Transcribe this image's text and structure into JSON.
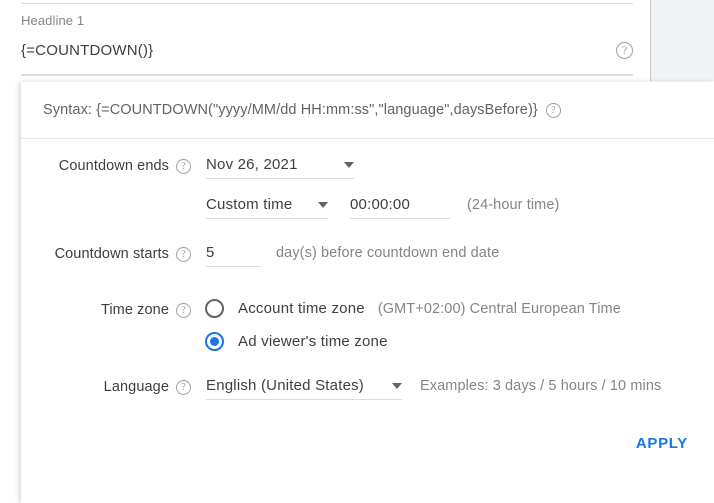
{
  "headline": {
    "label": "Headline 1",
    "value": "{=COUNTDOWN()}",
    "help_icon": "help-circle-icon"
  },
  "dialog": {
    "syntax": {
      "text": "Syntax: {=COUNTDOWN(\"yyyy/MM/dd HH:mm:ss\",\"language\",daysBefore)}",
      "help_icon": "help-circle-icon"
    },
    "countdown_ends": {
      "label": "Countdown ends",
      "date_value": "Nov 26, 2021",
      "time_mode_value": "Custom time",
      "time_value": "00:00:00",
      "time_hint": "(24-hour time)"
    },
    "countdown_starts": {
      "label": "Countdown starts",
      "days_value": "5",
      "hint": "day(s) before countdown end date"
    },
    "time_zone": {
      "label": "Time zone",
      "options": [
        {
          "label": "Account time zone",
          "sub": "(GMT+02:00) Central European Time",
          "selected": false
        },
        {
          "label": "Ad viewer's time zone",
          "sub": "",
          "selected": true
        }
      ]
    },
    "language": {
      "label": "Language",
      "value": "English (United States)",
      "hint": "Examples: 3 days / 5 hours / 10 mins"
    },
    "apply_label": "APPLY"
  },
  "colors": {
    "accent": "#1a73e8",
    "text_primary": "#3c4043",
    "text_secondary": "#80868b",
    "divider": "#dadce0",
    "panel_bg": "#f1f2f4"
  }
}
